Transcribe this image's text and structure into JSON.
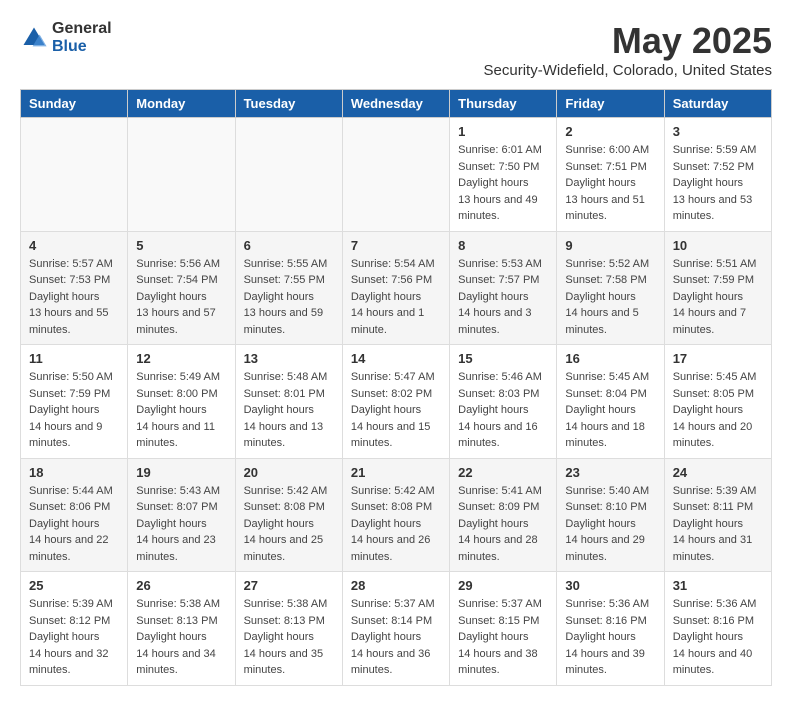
{
  "header": {
    "logo_general": "General",
    "logo_blue": "Blue",
    "month_title": "May 2025",
    "location": "Security-Widefield, Colorado, United States"
  },
  "days_of_week": [
    "Sunday",
    "Monday",
    "Tuesday",
    "Wednesday",
    "Thursday",
    "Friday",
    "Saturday"
  ],
  "weeks": [
    [
      {
        "day": "",
        "sunrise": "",
        "sunset": "",
        "daylight": "",
        "empty": true
      },
      {
        "day": "",
        "sunrise": "",
        "sunset": "",
        "daylight": "",
        "empty": true
      },
      {
        "day": "",
        "sunrise": "",
        "sunset": "",
        "daylight": "",
        "empty": true
      },
      {
        "day": "",
        "sunrise": "",
        "sunset": "",
        "daylight": "",
        "empty": true
      },
      {
        "day": "1",
        "sunrise": "6:01 AM",
        "sunset": "7:50 PM",
        "daylight": "13 hours and 49 minutes."
      },
      {
        "day": "2",
        "sunrise": "6:00 AM",
        "sunset": "7:51 PM",
        "daylight": "13 hours and 51 minutes."
      },
      {
        "day": "3",
        "sunrise": "5:59 AM",
        "sunset": "7:52 PM",
        "daylight": "13 hours and 53 minutes."
      }
    ],
    [
      {
        "day": "4",
        "sunrise": "5:57 AM",
        "sunset": "7:53 PM",
        "daylight": "13 hours and 55 minutes."
      },
      {
        "day": "5",
        "sunrise": "5:56 AM",
        "sunset": "7:54 PM",
        "daylight": "13 hours and 57 minutes."
      },
      {
        "day": "6",
        "sunrise": "5:55 AM",
        "sunset": "7:55 PM",
        "daylight": "13 hours and 59 minutes."
      },
      {
        "day": "7",
        "sunrise": "5:54 AM",
        "sunset": "7:56 PM",
        "daylight": "14 hours and 1 minute."
      },
      {
        "day": "8",
        "sunrise": "5:53 AM",
        "sunset": "7:57 PM",
        "daylight": "14 hours and 3 minutes."
      },
      {
        "day": "9",
        "sunrise": "5:52 AM",
        "sunset": "7:58 PM",
        "daylight": "14 hours and 5 minutes."
      },
      {
        "day": "10",
        "sunrise": "5:51 AM",
        "sunset": "7:59 PM",
        "daylight": "14 hours and 7 minutes."
      }
    ],
    [
      {
        "day": "11",
        "sunrise": "5:50 AM",
        "sunset": "7:59 PM",
        "daylight": "14 hours and 9 minutes."
      },
      {
        "day": "12",
        "sunrise": "5:49 AM",
        "sunset": "8:00 PM",
        "daylight": "14 hours and 11 minutes."
      },
      {
        "day": "13",
        "sunrise": "5:48 AM",
        "sunset": "8:01 PM",
        "daylight": "14 hours and 13 minutes."
      },
      {
        "day": "14",
        "sunrise": "5:47 AM",
        "sunset": "8:02 PM",
        "daylight": "14 hours and 15 minutes."
      },
      {
        "day": "15",
        "sunrise": "5:46 AM",
        "sunset": "8:03 PM",
        "daylight": "14 hours and 16 minutes."
      },
      {
        "day": "16",
        "sunrise": "5:45 AM",
        "sunset": "8:04 PM",
        "daylight": "14 hours and 18 minutes."
      },
      {
        "day": "17",
        "sunrise": "5:45 AM",
        "sunset": "8:05 PM",
        "daylight": "14 hours and 20 minutes."
      }
    ],
    [
      {
        "day": "18",
        "sunrise": "5:44 AM",
        "sunset": "8:06 PM",
        "daylight": "14 hours and 22 minutes."
      },
      {
        "day": "19",
        "sunrise": "5:43 AM",
        "sunset": "8:07 PM",
        "daylight": "14 hours and 23 minutes."
      },
      {
        "day": "20",
        "sunrise": "5:42 AM",
        "sunset": "8:08 PM",
        "daylight": "14 hours and 25 minutes."
      },
      {
        "day": "21",
        "sunrise": "5:42 AM",
        "sunset": "8:08 PM",
        "daylight": "14 hours and 26 minutes."
      },
      {
        "day": "22",
        "sunrise": "5:41 AM",
        "sunset": "8:09 PM",
        "daylight": "14 hours and 28 minutes."
      },
      {
        "day": "23",
        "sunrise": "5:40 AM",
        "sunset": "8:10 PM",
        "daylight": "14 hours and 29 minutes."
      },
      {
        "day": "24",
        "sunrise": "5:39 AM",
        "sunset": "8:11 PM",
        "daylight": "14 hours and 31 minutes."
      }
    ],
    [
      {
        "day": "25",
        "sunrise": "5:39 AM",
        "sunset": "8:12 PM",
        "daylight": "14 hours and 32 minutes."
      },
      {
        "day": "26",
        "sunrise": "5:38 AM",
        "sunset": "8:13 PM",
        "daylight": "14 hours and 34 minutes."
      },
      {
        "day": "27",
        "sunrise": "5:38 AM",
        "sunset": "8:13 PM",
        "daylight": "14 hours and 35 minutes."
      },
      {
        "day": "28",
        "sunrise": "5:37 AM",
        "sunset": "8:14 PM",
        "daylight": "14 hours and 36 minutes."
      },
      {
        "day": "29",
        "sunrise": "5:37 AM",
        "sunset": "8:15 PM",
        "daylight": "14 hours and 38 minutes."
      },
      {
        "day": "30",
        "sunrise": "5:36 AM",
        "sunset": "8:16 PM",
        "daylight": "14 hours and 39 minutes."
      },
      {
        "day": "31",
        "sunrise": "5:36 AM",
        "sunset": "8:16 PM",
        "daylight": "14 hours and 40 minutes."
      }
    ]
  ],
  "labels": {
    "sunrise": "Sunrise:",
    "sunset": "Sunset:",
    "daylight": "Daylight hours"
  }
}
